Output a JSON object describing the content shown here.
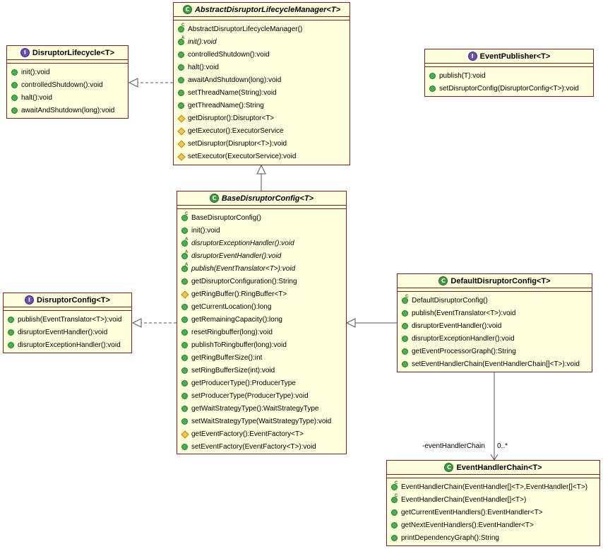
{
  "classes": {
    "abstract_manager": {
      "name": "AbstractDisruptorLifecycleManager<T>",
      "kind": "abstract",
      "members": [
        {
          "text": "AbstractDisruptorLifecycleManager()",
          "vis": "public",
          "badge": "C"
        },
        {
          "text": "init():void",
          "vis": "public",
          "badge": "A",
          "italic": true
        },
        {
          "text": "controlledShutdown():void",
          "vis": "public"
        },
        {
          "text": "halt():void",
          "vis": "public"
        },
        {
          "text": "awaitAndShutdown(long):void",
          "vis": "public"
        },
        {
          "text": "setThreadName(String):void",
          "vis": "public"
        },
        {
          "text": "getThreadName():String",
          "vis": "public"
        },
        {
          "text": "getDisruptor():Disruptor<T>",
          "vis": "protected"
        },
        {
          "text": "getExecutor():ExecutorService",
          "vis": "protected"
        },
        {
          "text": "setDisruptor(Disruptor<T>):void",
          "vis": "protected"
        },
        {
          "text": "setExecutor(ExecutorService):void",
          "vis": "protected"
        }
      ]
    },
    "disruptor_lifecycle": {
      "name": "DisruptorLifecycle<T>",
      "kind": "interface",
      "members": [
        {
          "text": "init():void",
          "vis": "public"
        },
        {
          "text": "controlledShutdown():void",
          "vis": "public"
        },
        {
          "text": "halt():void",
          "vis": "public"
        },
        {
          "text": "awaitAndShutdown(long):void",
          "vis": "public"
        }
      ]
    },
    "event_publisher": {
      "name": "EventPublisher<T>",
      "kind": "interface",
      "members": [
        {
          "text": "publish(T):void",
          "vis": "public"
        },
        {
          "text": "setDisruptorConfig(DisruptorConfig<T>):void",
          "vis": "public"
        }
      ]
    },
    "base_config": {
      "name": "BaseDisruptorConfig<T>",
      "kind": "abstract",
      "members": [
        {
          "text": "BaseDisruptorConfig()",
          "vis": "public",
          "badge": "C"
        },
        {
          "text": "init():void",
          "vis": "public"
        },
        {
          "text": "disruptorExceptionHandler():void",
          "vis": "public",
          "badge": "A",
          "italic": true
        },
        {
          "text": "disruptorEventHandler():void",
          "vis": "public",
          "badge": "A",
          "italic": true
        },
        {
          "text": "publish(EventTranslator<T>):void",
          "vis": "public",
          "badge": "A",
          "italic": true
        },
        {
          "text": "getDisruptorConfiguration():String",
          "vis": "public"
        },
        {
          "text": "getRingBuffer():RingBuffer<T>",
          "vis": "protected"
        },
        {
          "text": "getCurrentLocation():long",
          "vis": "public"
        },
        {
          "text": "getRemainingCapacity():long",
          "vis": "public"
        },
        {
          "text": "resetRingbuffer(long):void",
          "vis": "public"
        },
        {
          "text": "publishToRingbuffer(long):void",
          "vis": "public"
        },
        {
          "text": "getRingBufferSize():int",
          "vis": "public"
        },
        {
          "text": "setRingBufferSize(int):void",
          "vis": "public"
        },
        {
          "text": "getProducerType():ProducerType",
          "vis": "public"
        },
        {
          "text": "setProducerType(ProducerType):void",
          "vis": "public"
        },
        {
          "text": "getWaitStrategyType():WaitStrategyType",
          "vis": "public"
        },
        {
          "text": "setWaitStrategyType(WaitStrategyType):void",
          "vis": "public"
        },
        {
          "text": "getEventFactory():EventFactory<T>",
          "vis": "protected"
        },
        {
          "text": "setEventFactory(EventFactory<T>):void",
          "vis": "public"
        }
      ]
    },
    "disruptor_config": {
      "name": "DisruptorConfig<T>",
      "kind": "interface",
      "members": [
        {
          "text": "publish(EventTranslator<T>):void",
          "vis": "public"
        },
        {
          "text": "disruptorEventHandler():void",
          "vis": "public"
        },
        {
          "text": "disruptorExceptionHandler():void",
          "vis": "public"
        }
      ]
    },
    "default_config": {
      "name": "DefaultDisruptorConfig<T>",
      "kind": "class",
      "members": [
        {
          "text": "DefaultDisruptorConfig()",
          "vis": "public",
          "badge": "C"
        },
        {
          "text": "publish(EventTranslator<T>):void",
          "vis": "public"
        },
        {
          "text": "disruptorEventHandler():void",
          "vis": "public"
        },
        {
          "text": "disruptorExceptionHandler():void",
          "vis": "public"
        },
        {
          "text": "getEventProcessorGraph():String",
          "vis": "public"
        },
        {
          "text": "setEventHandlerChain(EventHandlerChain[]<T>):void",
          "vis": "public"
        }
      ]
    },
    "event_handler_chain": {
      "name": "EventHandlerChain<T>",
      "kind": "class",
      "members": [
        {
          "text": "EventHandlerChain(EventHandler[]<T>,EventHandler[]<T>)",
          "vis": "public",
          "badge": "C"
        },
        {
          "text": "EventHandlerChain(EventHandler[]<T>)",
          "vis": "public",
          "badge": "C"
        },
        {
          "text": "getCurrentEventHandlers():EventHandler<T>",
          "vis": "public"
        },
        {
          "text": "getNextEventHandlers():EventHandler<T>",
          "vis": "public"
        },
        {
          "text": "printDependencyGraph():String",
          "vis": "public"
        }
      ]
    }
  },
  "association": {
    "role": "-eventHandlerChain",
    "multiplicity": "0..*"
  },
  "colors": {
    "box_fill": "#ffffdd",
    "box_border": "#8b1a1a",
    "edge": "#555555"
  }
}
